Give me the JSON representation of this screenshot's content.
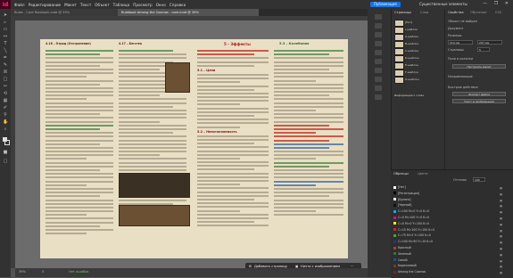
{
  "app": {
    "logo": "Id",
    "menu": [
      "Файл",
      "Редактирование",
      "Макет",
      "Текст",
      "Объект",
      "Таблица",
      "Просмотр",
      "Окно",
      "Справка"
    ],
    "publish_label": "Публикация",
    "workspace_label": "Существенные элементы",
    "window_controls": "— ❐ ✕"
  },
  "tabs": [
    {
      "label": "Rules - Core Rulebook.indd @ 39%"
    },
    {
      "label": "Rulebook Among the Cosmos - core.indd @ 39%",
      "active": true
    }
  ],
  "pages": {
    "left_header_a": "4.16 – Отряд (Отстранение)",
    "left_header_b": "4.17 – Бегство",
    "right_header_a": "5 – Эффекты",
    "right_header_b": "5.3 – Колебания",
    "section_5_1": "5.1 – Цепи",
    "section_5_2": "5.2 – Непотопляемость"
  },
  "status": {
    "zoom": "39%",
    "page": "5",
    "errors": "Нет ошибок"
  },
  "floatbar": {
    "add_pages": "Добавить страницу",
    "actions": "Ничто с изображением"
  },
  "panel_pages": {
    "tab_pages": "Страницы",
    "tab_layers": "Слои",
    "entries": [
      "[Нет]",
      "I-шаблон",
      "A-шаблон",
      "B-шаблон",
      "C-шаблон",
      "D-шаблон",
      "E-шаблон",
      "F-шаблон",
      "G-шаблон"
    ],
    "section_label": "Информация о слоях"
  },
  "panel_props": {
    "tab_props": "Свойства",
    "tab_cc": "Обучение",
    "tab_css": "CSS",
    "object_label": "Объект не выбран",
    "doc_label": "Документ",
    "size_label": "Размеры",
    "w_value": "210 мм",
    "h_value": "297 мм",
    "pages_label": "Страницы",
    "pages_count": "5",
    "margins_label": "Поля и колонки",
    "adjust_layout": "Настроить макет",
    "grid_label": "Направляющие",
    "quick_actions": "Быстрые действия",
    "export_label": "Экспорт файла",
    "text_mode": "Текст в изображении"
  },
  "panel_layers": {
    "tab_layers": "Образцы",
    "tab_swatches": "Цвета",
    "tint_label": "Оттенок",
    "tint_value": "100",
    "rows": [
      {
        "name": "[Нет]",
        "color": "#ffffff"
      },
      {
        "name": "[Регистрация]",
        "color": "#000000"
      },
      {
        "name": "[Бумага]",
        "color": "#f5f5f5"
      },
      {
        "name": "[Черный]",
        "color": "#111111"
      },
      {
        "name": "C=100 M=0 Y=0 K=0",
        "color": "#00aeef"
      },
      {
        "name": "C=0 M=100 Y=0 K=0",
        "color": "#ec008c"
      },
      {
        "name": "C=0 M=0 Y=100 K=0",
        "color": "#fff200"
      },
      {
        "name": "C=15 M=100 Y=100 K=0",
        "color": "#d2232a"
      },
      {
        "name": "C=75 M=5 Y=100 K=0",
        "color": "#3aaa35"
      },
      {
        "name": "C=100 M=90 Y=10 K=0",
        "color": "#2e3192"
      },
      {
        "name": "Красный",
        "color": "#c0392b"
      },
      {
        "name": "Зеленый",
        "color": "#2e7d32"
      },
      {
        "name": "Синий",
        "color": "#1f4e9c"
      },
      {
        "name": "Коричневый",
        "color": "#6b4226"
      },
      {
        "name": "Among the Cosmos",
        "color": "#8b1d1d"
      }
    ]
  }
}
